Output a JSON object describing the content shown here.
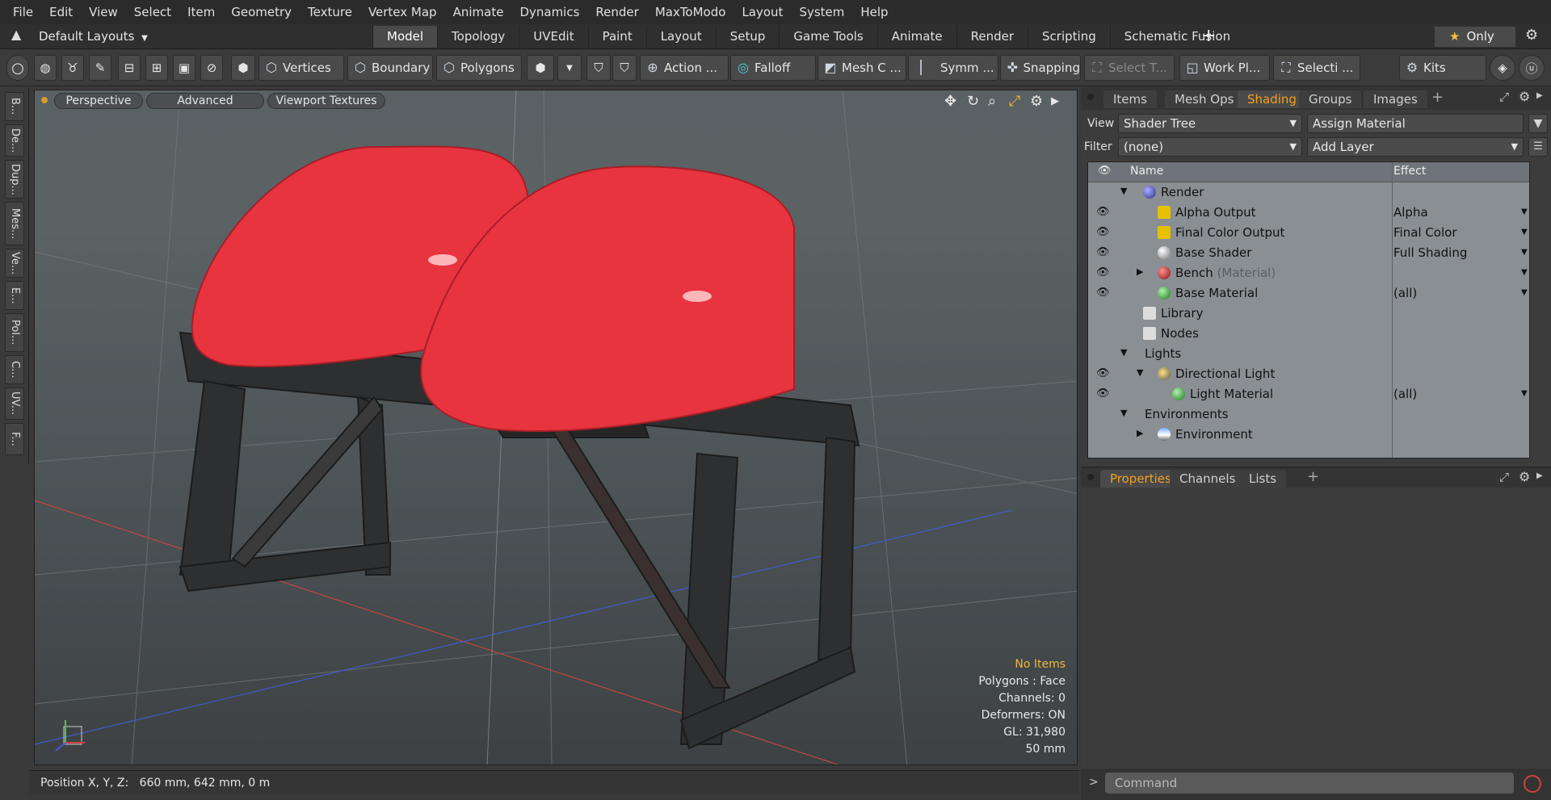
{
  "menu": [
    "File",
    "Edit",
    "View",
    "Select",
    "Item",
    "Geometry",
    "Texture",
    "Vertex Map",
    "Animate",
    "Dynamics",
    "Render",
    "MaxToModo",
    "Layout",
    "System",
    "Help"
  ],
  "layout_select": "Default Layouts",
  "tabs": [
    "Model",
    "Topology",
    "UVEdit",
    "Paint",
    "Layout",
    "Setup",
    "Game Tools",
    "Animate",
    "Render",
    "Scripting",
    "Schematic Fusion"
  ],
  "active_tab": "Model",
  "only_label": "Only",
  "toolbar": {
    "vertices": "Vertices",
    "boundary": "Boundary",
    "polygons": "Polygons",
    "action": "Action ...",
    "falloff": "Falloff",
    "mesh_c": "Mesh C ...",
    "symm": "Symm ...",
    "snapping": "Snapping",
    "select_t": "Select T...",
    "work_pl": "Work Pl...",
    "selecti": "Selecti ...",
    "kits": "Kits"
  },
  "left_tabs": [
    "B...",
    "De...",
    "Dup...",
    "Mes...",
    "Ve...",
    "E...",
    "Pol...",
    "C...",
    "UV...",
    "F..."
  ],
  "viewport": {
    "perspective": "Perspective",
    "advanced": "Advanced",
    "viewport_textures": "Viewport Textures",
    "hud": {
      "no_items": "No Items",
      "polygons": "Polygons : Face",
      "channels": "Channels: 0",
      "deformers": "Deformers: ON",
      "gl": "GL: 31,980",
      "focal": "50 mm"
    }
  },
  "status": "Position X, Y, Z:   660 mm, 642 mm, 0 m",
  "right_tabs": [
    "Items",
    "Mesh Ops",
    "Shading",
    "Groups",
    "Images"
  ],
  "active_right_tab": "Shading",
  "view_label": "View",
  "view_value": "Shader Tree",
  "assign_material": "Assign Material",
  "filter_label": "Filter",
  "filter_value": "(none)",
  "add_layer": "Add Layer",
  "tree_header": {
    "name": "Name",
    "effect": "Effect"
  },
  "tree_rows": [
    {
      "name": "Render",
      "effect": "",
      "sub": "",
      "eye": true
    },
    {
      "name": "Alpha Output",
      "effect": "Alpha",
      "sub": "",
      "eye": true
    },
    {
      "name": "Final Color Output",
      "effect": "Final Color",
      "sub": "",
      "eye": true
    },
    {
      "name": "Base Shader",
      "effect": "Full Shading",
      "sub": "",
      "eye": true
    },
    {
      "name": "Bench",
      "effect": "",
      "sub": "(Material)",
      "eye": true
    },
    {
      "name": "Base Material",
      "effect": "(all)",
      "sub": "",
      "eye": true
    },
    {
      "name": "Library",
      "effect": "",
      "sub": "",
      "eye": false
    },
    {
      "name": "Nodes",
      "effect": "",
      "sub": "",
      "eye": false
    },
    {
      "name": "Lights",
      "effect": "",
      "sub": "",
      "eye": false
    },
    {
      "name": "Directional Light",
      "effect": "",
      "sub": "",
      "eye": true
    },
    {
      "name": "Light Material",
      "effect": "(all)",
      "sub": "",
      "eye": true
    },
    {
      "name": "Environments",
      "effect": "",
      "sub": "",
      "eye": false
    },
    {
      "name": "Environment",
      "effect": "",
      "sub": "",
      "eye": false
    }
  ],
  "props_tabs": [
    "Properties",
    "Channels",
    "Lists"
  ],
  "active_props_tab": "Properties",
  "command_placeholder": "Command",
  "colors": {
    "accent": "#f0a020",
    "seat_red": "#e8343f",
    "frame": "#2f2f2f"
  }
}
